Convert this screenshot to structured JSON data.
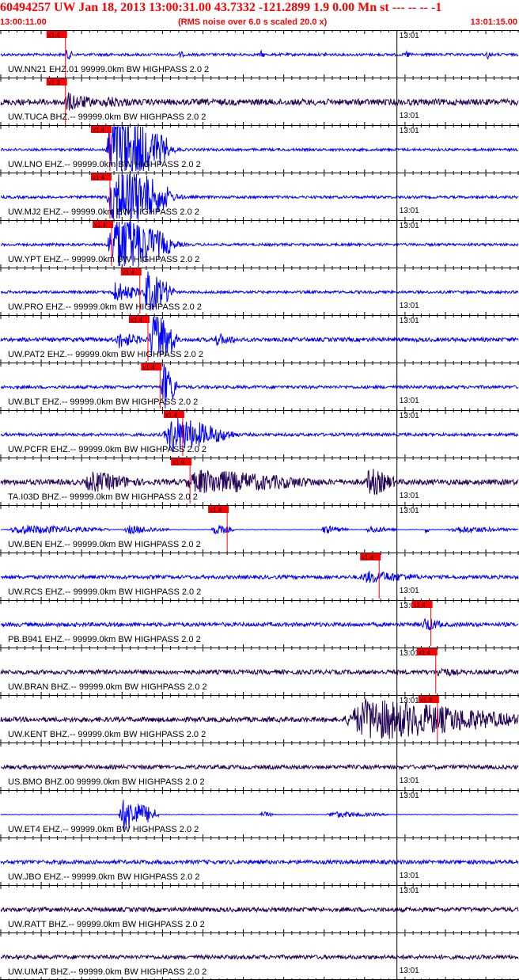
{
  "header": {
    "title": "60494257 UW Jan 18, 2013 13:00:31.00   43.7332 -121.2899  1.9 0.00 Mn st --- -- --  -1",
    "start_time": "13:00:11.00",
    "noise_note": "(RMS noise over 6.0 s scaled 20.0 x)",
    "end_time": "13:01:15.00"
  },
  "colors": {
    "title": "#ff0000",
    "trace_blue": "#0000ff",
    "trace_dark": "#220055",
    "pick": "#ff0000",
    "grid": "#000000"
  },
  "chart_data": {
    "type": "line",
    "title": "60494257 UW Jan 18, 2013 13:00:31.00   43.7332 -121.2899  1.9 0.00 Mn st --- -- --  -1",
    "x_start": "13:00:11.00",
    "x_end": "13:01:15.00",
    "minute_marker": "13:01",
    "minute_marker_seconds": 49,
    "duration_seconds": 64,
    "series": [
      {
        "label": "UW.NN21 EHZ.01 99999.0km BW  HIGHPASS  2.0  2",
        "pick": "x1.4",
        "pick_seconds": 8.0,
        "color": "#0000ff",
        "bursts": [
          [
            8.0,
            1.0,
            0.6
          ],
          [
            13.0,
            0.6,
            0.4
          ],
          [
            22.0,
            0.8,
            0.4
          ],
          [
            32.0,
            0.8,
            0.4
          ],
          [
            40.0,
            0.6,
            0.35
          ],
          [
            50.0,
            1.0,
            0.4
          ],
          [
            60.0,
            1.0,
            0.45
          ]
        ],
        "noise": 0.12
      },
      {
        "label": "UW.TUCA BHZ.-- 99999.0km BW  HIGHPASS  2.0  2",
        "pick": "x1.3",
        "pick_seconds": 8.0,
        "color": "#220055",
        "bursts": [
          [
            7.5,
            5.0,
            0.9
          ],
          [
            12.0,
            6.0,
            0.6
          ]
        ],
        "noise": 0.28
      },
      {
        "label": "UW.LNO EHZ.-- 99999.0km BW  HIGHPASS  2.0  2",
        "pick": "x1.4",
        "pick_seconds": 13.5,
        "color": "#0000ff",
        "bursts": [
          [
            12.8,
            8.0,
            4.0
          ],
          [
            20.0,
            3.0,
            0.4
          ]
        ],
        "noise": 0.12
      },
      {
        "label": "UW.MJ2 EHZ.-- 99999.0km BW  HIGHPASS  2.0  2",
        "pick": "x1.4",
        "pick_seconds": 13.5,
        "color": "#0000ff",
        "bursts": [
          [
            13.0,
            8.0,
            3.5
          ],
          [
            20.0,
            3.0,
            0.5
          ]
        ],
        "noise": 0.12
      },
      {
        "label": "UW.YPT EHZ.-- 99999.0km BW  HIGHPASS  2.0  2",
        "pick": "x1.4",
        "pick_seconds": 13.7,
        "color": "#0000ff",
        "bursts": [
          [
            13.0,
            8.0,
            3.2
          ],
          [
            20.0,
            3.0,
            0.5
          ]
        ],
        "noise": 0.12
      },
      {
        "label": "UW.PRO EHZ.-- 99999.0km BW  HIGHPASS  2.0  2",
        "pick": "x1.4",
        "pick_seconds": 17.2,
        "color": "#0000ff",
        "bursts": [
          [
            13.5,
            4.0,
            1.0
          ],
          [
            17.5,
            4.0,
            2.0
          ]
        ],
        "noise": 0.12
      },
      {
        "label": "UW.PAT2 EHZ.-- 99999.0km BW  HIGHPASS  2.0  2",
        "pick": "x1.4",
        "pick_seconds": 18.2,
        "color": "#0000ff",
        "bursts": [
          [
            14.0,
            4.0,
            0.8
          ],
          [
            18.3,
            3.5,
            3.0
          ],
          [
            26.0,
            4.0,
            0.6
          ]
        ],
        "noise": 0.18
      },
      {
        "label": "UW.BLT EHZ.-- 99999.0km BW  HIGHPASS  2.0  2",
        "pick": "x1.4",
        "pick_seconds": 19.7,
        "color": "#0000ff",
        "bursts": [
          [
            19.8,
            2.0,
            2.5
          ]
        ],
        "noise": 0.14
      },
      {
        "label": "UW.PCFR EHZ.-- 99999.0km BW  HIGHPASS  2.0  2",
        "pick": "x1.4",
        "pick_seconds": 22.5,
        "color": "#0000ff",
        "bursts": [
          [
            20.0,
            8.0,
            1.8
          ],
          [
            26.5,
            3.0,
            0.7
          ]
        ],
        "noise": 0.14
      },
      {
        "label": "TA.I03D BHZ.-- 99999.0km BW  HIGHPASS  2.0  2",
        "pick": "x1.4",
        "pick_seconds": 23.4,
        "color": "#220055",
        "bursts": [
          [
            10.0,
            8.0,
            1.0
          ],
          [
            22.0,
            18.0,
            1.2
          ],
          [
            45.0,
            4.0,
            1.4
          ]
        ],
        "noise": 0.25
      },
      {
        "label": "UW.BEN EHZ.-- 99999.0km BW  HIGHPASS  2.0  2",
        "pick": "x1.4",
        "pick_seconds": 28.0,
        "color": "#0000ff",
        "bursts": [
          [
            0.5,
            13.0,
            0.45
          ],
          [
            15.0,
            6.0,
            0.4
          ],
          [
            26.0,
            3.0,
            0.5
          ],
          [
            39.5,
            3.5,
            0.4
          ],
          [
            45.0,
            4.0,
            0.35
          ],
          [
            52.5,
            0.5,
            0.5
          ],
          [
            55.0,
            9.0,
            0.35
          ]
        ],
        "noise": 0.02
      },
      {
        "label": "UW.RCS EHZ.-- 99999.0km BW  HIGHPASS  2.0  2",
        "pick": "x1.4",
        "pick_seconds": 46.8,
        "color": "#0000ff",
        "bursts": [
          [
            44.0,
            9.0,
            0.6
          ]
        ],
        "noise": 0.16
      },
      {
        "label": "PB.B941 EHZ.-- 99999.0km BW  HIGHPASS  2.0  2",
        "pick": "x1.4",
        "pick_seconds": 53.2,
        "color": "#0000ff",
        "bursts": [
          [
            52.0,
            3.0,
            0.7
          ]
        ],
        "noise": 0.18
      },
      {
        "label": "UW.BRAN BHZ.-- 99999.0km BW  HIGHPASS  2.0  2",
        "pick": "x1.4",
        "pick_seconds": 53.8,
        "color": "#220055",
        "bursts": [
          [
            53.5,
            4.0,
            0.5
          ]
        ],
        "noise": 0.2
      },
      {
        "label": "UW.KENT BHZ.-- 99999.0km BW  HIGHPASS  2.0  2",
        "pick": "x1.3",
        "pick_seconds": 54.0,
        "color": "#220055",
        "bursts": [
          [
            42.0,
            22.0,
            2.0
          ]
        ],
        "noise": 0.22
      },
      {
        "label": "US.BMO BHZ.00 99999.0km BW  HIGHPASS  2.0  2",
        "pick": "",
        "pick_seconds": null,
        "color": "#220055",
        "bursts": [],
        "noise": 0.18
      },
      {
        "label": "UW.ET4 EHZ.-- 99999.0km BW  HIGHPASS  2.0  2",
        "pick": "",
        "pick_seconds": null,
        "color": "#0000ff",
        "bursts": [
          [
            14.5,
            5.0,
            1.6
          ],
          [
            32.0,
            2.0,
            0.3
          ],
          [
            40.0,
            8.0,
            0.3
          ]
        ],
        "noise": 0.03
      },
      {
        "label": "UW.JBO EHZ.-- 99999.0km BW  HIGHPASS  2.0  2",
        "pick": "",
        "pick_seconds": null,
        "color": "#0000ff",
        "bursts": [],
        "noise": 0.18
      },
      {
        "label": "UW.RATT BHZ.-- 99999.0km BW  HIGHPASS  2.0  2",
        "pick": "",
        "pick_seconds": null,
        "color": "#220055",
        "bursts": [],
        "noise": 0.2
      },
      {
        "label": "UW.UMAT BHZ.-- 99999.0km BW  HIGHPASS  2.0  2",
        "pick": "",
        "pick_seconds": null,
        "color": "#220055",
        "bursts": [],
        "noise": 0.18
      }
    ]
  }
}
